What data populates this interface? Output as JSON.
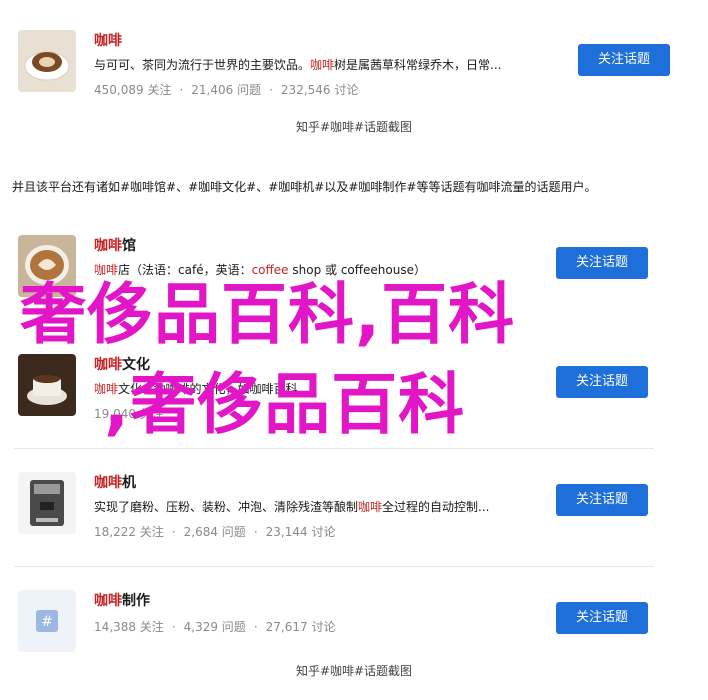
{
  "cards": [
    {
      "title_hl": "咖啡",
      "title_plain": "",
      "desc_parts": [
        "与可可、茶同为流行于世界的主要饮品。",
        "咖啡",
        "树是属茜草科常绿乔木，日常..."
      ],
      "followers": "450,089 关注",
      "questions": "21,406 问题",
      "discussions": "232,546 讨论",
      "button": "关注话题"
    },
    {
      "title_hl": "咖啡",
      "title_plain": "馆",
      "desc_parts": [
        "咖啡",
        "店（法语：café，英语：",
        "coffee",
        " shop 或 coffeehouse）"
      ],
      "followers": "",
      "questions": "",
      "discussions": "",
      "button": "关注话题"
    },
    {
      "title_hl": "咖啡",
      "title_plain": "文化",
      "desc_parts": [
        "咖啡",
        "文化",
        "",
        "...种咖啡的文化，如咖啡百科"
      ],
      "followers": "19,040 关注",
      "questions": "",
      "discussions": "",
      "button": "关注话题"
    },
    {
      "title_hl": "咖啡",
      "title_plain": "机",
      "desc_parts": [
        "实现了磨粉、压粉、装粉、冲泡、清除残渣等酿制",
        "咖啡",
        "全过程的自动控制..."
      ],
      "followers": "18,222 关注",
      "questions": "2,684 问题",
      "discussions": "23,144 讨论",
      "button": "关注话题"
    },
    {
      "title_hl": "咖啡",
      "title_plain": "制作",
      "desc_parts": [
        "",
        "",
        "",
        ""
      ],
      "followers": "14,388 关注",
      "questions": "4,329 问题",
      "discussions": "27,617 讨论",
      "button": "关注话题"
    }
  ],
  "caption_top": "知乎#咖啡#话题截图",
  "caption_bottom": "知乎#咖啡#话题截图",
  "paragraph": "并且该平台还有诸如#咖啡馆#、#咖啡文化#、#咖啡机#以及#咖啡制作#等等话题有咖啡流量的话题用户。",
  "overlay_line1": "奢侈品百科,百科",
  "overlay_line2": ",奢侈品百科",
  "colors": {
    "accent": "#1e6fd9",
    "highlight": "#c62222",
    "overlay": "#e216c7"
  }
}
